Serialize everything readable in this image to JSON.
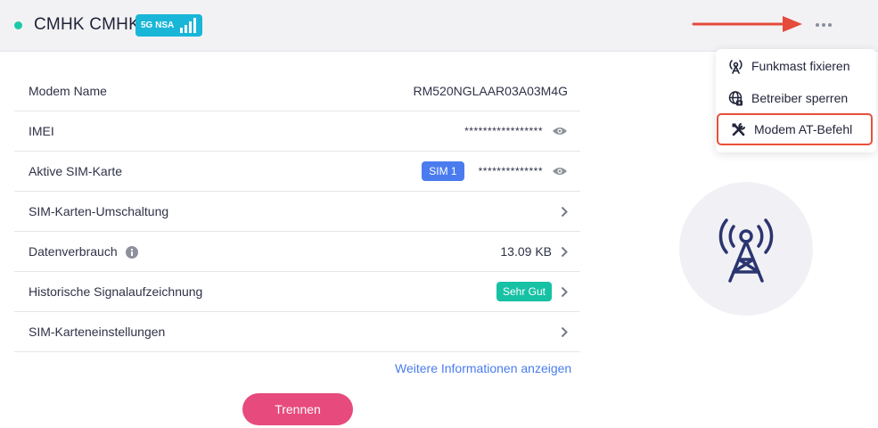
{
  "header": {
    "carrier": "CMHK CMHK",
    "network_badge": "5G NSA",
    "more_icon": "more-horizontal-icon",
    "status_color": "#1ec9a8"
  },
  "menu": {
    "items": [
      {
        "label": "Funkmast fixieren",
        "icon": "cell-tower-icon"
      },
      {
        "label": "Betreiber sperren",
        "icon": "globe-lock-icon"
      },
      {
        "label": "Modem AT-Befehl",
        "icon": "tools-icon",
        "highlighted": true
      }
    ]
  },
  "details": {
    "modem_name": {
      "label": "Modem Name",
      "value": "RM520NGLAAR03A03M4G"
    },
    "imei": {
      "label": "IMEI",
      "value": "*****************"
    },
    "active_sim": {
      "label": "Aktive SIM-Karte",
      "chip": "SIM 1",
      "value": "**************"
    },
    "sim_switch": {
      "label": "SIM-Karten-Umschaltung"
    },
    "data_usage": {
      "label": "Datenverbrauch",
      "value": "13.09 KB"
    },
    "signal_history": {
      "label": "Historische Signalaufzeichnung",
      "badge": "Sehr Gut"
    },
    "sim_settings": {
      "label": "SIM-Karteneinstellungen"
    }
  },
  "more_info": "Weitere Informationen anzeigen",
  "disconnect": "Trennen",
  "colors": {
    "accent": "#4a7cf0",
    "good": "#17c1a4",
    "danger": "#e74a7d",
    "highlight": "#e8503a",
    "badge": "#19b6d8"
  }
}
